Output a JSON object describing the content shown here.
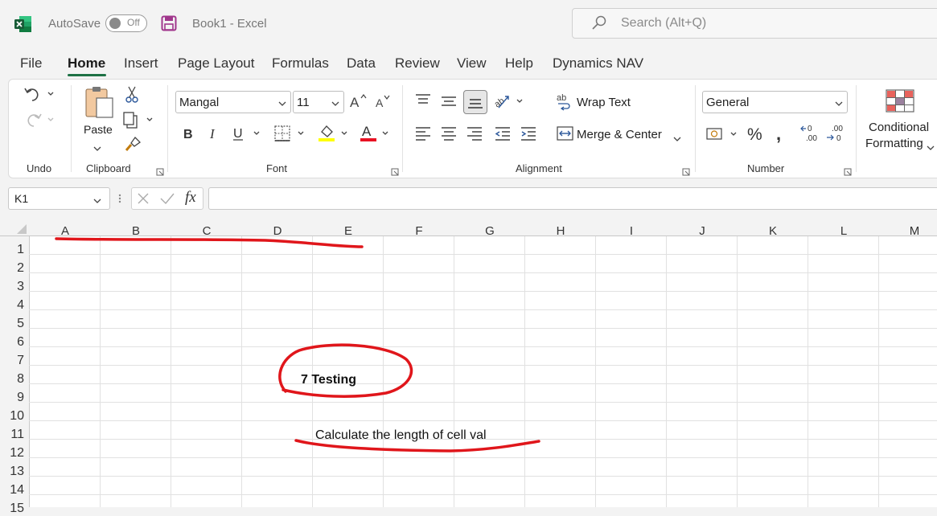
{
  "titlebar": {
    "autosave_label": "AutoSave",
    "autosave_state": "Off",
    "document_title": "Book1  -  Excel",
    "search_placeholder": "Search (Alt+Q)"
  },
  "menu": {
    "tabs": [
      "File",
      "Home",
      "Insert",
      "Page Layout",
      "Formulas",
      "Data",
      "Review",
      "View",
      "Help",
      "Dynamics NAV"
    ],
    "active_tab": "Home"
  },
  "ribbon": {
    "undo_group": "Undo",
    "clipboard_group": "Clipboard",
    "paste_label": "Paste",
    "font_group": "Font",
    "font_name": "Mangal",
    "font_size": "11",
    "alignment_group": "Alignment",
    "wrap_text": "Wrap Text",
    "merge_center": "Merge & Center",
    "number_group": "Number",
    "number_format": "General",
    "conditional_formatting_line1": "Conditional",
    "conditional_formatting_line2": "Formatting",
    "accent_fill_color": "#ffff00",
    "accent_font_color": "#e81123"
  },
  "formula_bar": {
    "name_box": "K1",
    "fx": "fx",
    "formula": ""
  },
  "grid": {
    "columns": [
      "A",
      "B",
      "C",
      "D",
      "E",
      "F",
      "G",
      "H",
      "I",
      "J",
      "K",
      "L",
      "M"
    ],
    "rows": [
      "1",
      "2",
      "3",
      "4",
      "5",
      "6",
      "7",
      "8",
      "9",
      "10",
      "11",
      "12",
      "13",
      "14",
      "15"
    ],
    "cells": {
      "E8": "7 Testing",
      "E11": "Calculate  the  length  of  cell  val"
    }
  },
  "colors": {
    "excel_green": "#1e7145",
    "annotation_red": "#e0161b"
  }
}
